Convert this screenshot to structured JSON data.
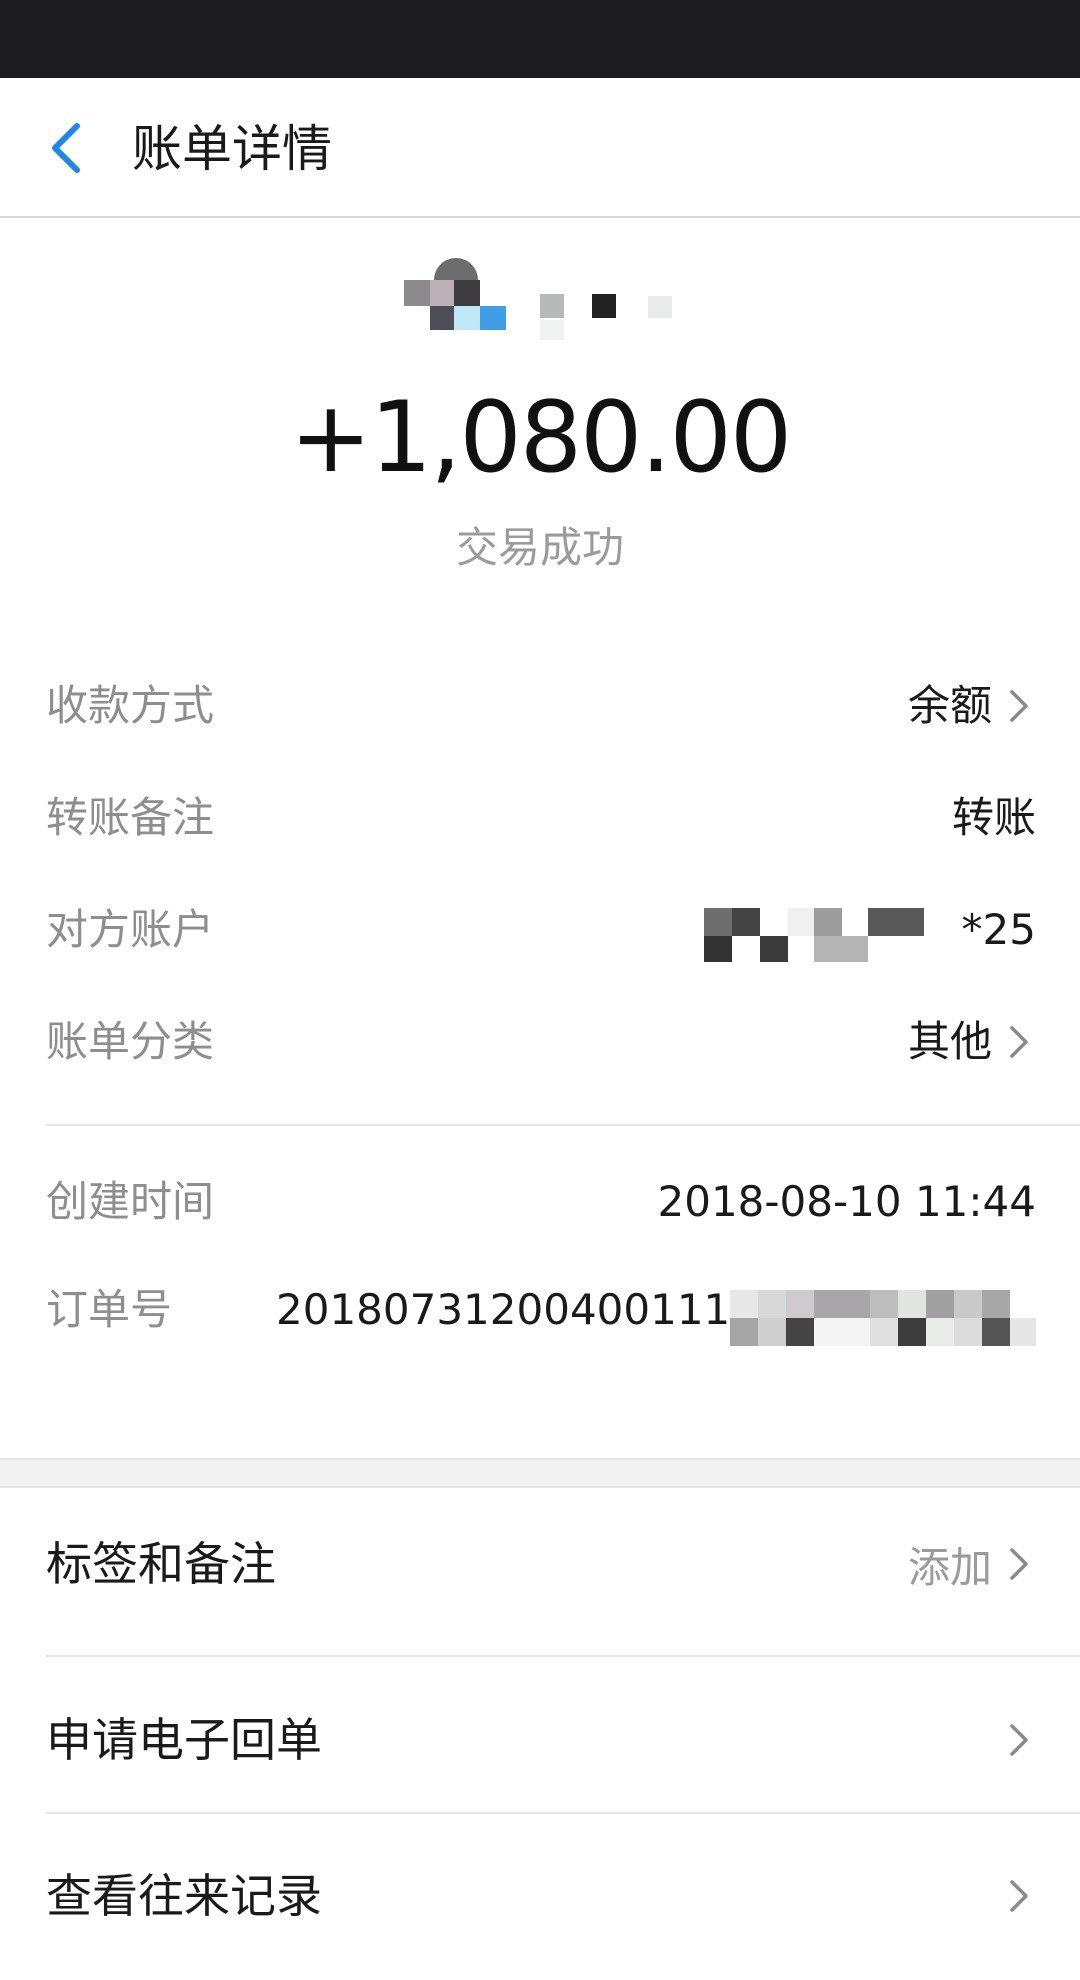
{
  "nav": {
    "title": "账单详情",
    "back_icon": "chevron-left-icon",
    "accent": "#1e88e5"
  },
  "header": {
    "amount": "+1,080.00",
    "status": "交易成功"
  },
  "details": [
    {
      "label": "收款方式",
      "value": "余额",
      "has_arrow": true
    },
    {
      "label": "转账备注",
      "value": "转账",
      "has_arrow": false
    },
    {
      "label": "对方账户",
      "value": "*25",
      "has_arrow": false
    },
    {
      "label": "账单分类",
      "value": "其他",
      "has_arrow": true
    }
  ],
  "meta": {
    "created_label": "创建时间",
    "created_value": "2018-08-10 11:44",
    "order_label": "订单号",
    "order_value": "2018073120040011​1"
  },
  "actions": [
    {
      "label": "标签和备注",
      "right_text": "添加"
    },
    {
      "label": "申请电子回单",
      "right_text": ""
    },
    {
      "label": "查看往来记录",
      "right_text": ""
    }
  ]
}
